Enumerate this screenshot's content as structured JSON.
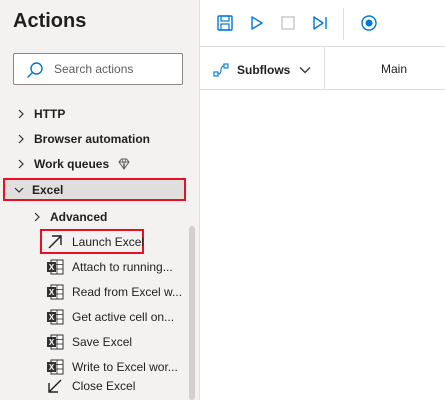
{
  "panel": {
    "title": "Actions",
    "search_placeholder": "Search actions"
  },
  "tree": {
    "http": "HTTP",
    "browser_automation": "Browser automation",
    "work_queues": "Work queues",
    "excel": "Excel",
    "advanced": "Advanced"
  },
  "actions": [
    {
      "label": "Launch Excel",
      "icon": "launch-arrow-icon"
    },
    {
      "label": "Attach to running...",
      "icon": "excel-icon"
    },
    {
      "label": "Read from Excel w...",
      "icon": "excel-icon"
    },
    {
      "label": "Get active cell on...",
      "icon": "excel-icon"
    },
    {
      "label": "Save Excel",
      "icon": "excel-icon"
    },
    {
      "label": "Write to Excel wor...",
      "icon": "excel-icon"
    },
    {
      "label": "Close Excel",
      "icon": "close-arrow-icon"
    }
  ],
  "tabs": {
    "subflows": "Subflows",
    "main": "Main"
  },
  "colors": {
    "accent": "#0078d4",
    "highlight": "#e81123",
    "excel_green": "#217346"
  }
}
